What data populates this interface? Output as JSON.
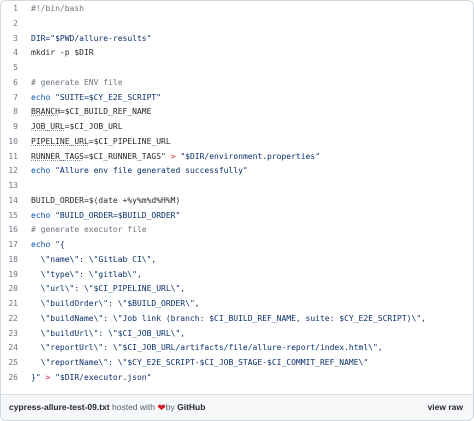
{
  "lines": [
    [
      {
        "t": "#!/bin/bash",
        "c": "t-comment"
      }
    ],
    [],
    [
      {
        "t": "DIR=\"$PWD/allure-results\"",
        "c": "t-str"
      }
    ],
    [
      {
        "t": "mkdir -p $DIR",
        "c": ""
      }
    ],
    [],
    [
      {
        "t": "# generate ENV file",
        "c": "t-comment"
      }
    ],
    [
      {
        "t": "echo",
        "c": "t-kw"
      },
      {
        "t": " \"SUITE=$CY_E2E_SCRIPT\"",
        "c": "t-str"
      }
    ],
    [
      {
        "t": "BRANCH",
        "c": "t-var"
      },
      {
        "t": "=$CI_BUILD_REF_NAME",
        "c": ""
      }
    ],
    [
      {
        "t": "JOB_URL",
        "c": "t-var"
      },
      {
        "t": "=$CI_JOB_URL",
        "c": ""
      }
    ],
    [
      {
        "t": "PIPELINE_URL",
        "c": "t-var"
      },
      {
        "t": "=$CI_PIPELINE_URL",
        "c": ""
      }
    ],
    [
      {
        "t": "RUNNER_TAGS",
        "c": "t-var"
      },
      {
        "t": "=$CI_RUNNER_TAGS\" ",
        "c": ""
      },
      {
        "t": ">",
        "c": "t-op"
      },
      {
        "t": " \"$DIR/environment.properties\"",
        "c": "t-str"
      }
    ],
    [
      {
        "t": "echo",
        "c": "t-kw"
      },
      {
        "t": " \"Allure env file generated successfully\"",
        "c": "t-str"
      }
    ],
    [],
    [
      {
        "t": "BUILD_ORDER=$(date +%y%m%d%H%M)",
        "c": ""
      }
    ],
    [
      {
        "t": "echo",
        "c": "t-kw"
      },
      {
        "t": " \"BUILD_ORDER=$BUILD_ORDER\"",
        "c": "t-str"
      }
    ],
    [
      {
        "t": "# generate executor file",
        "c": "t-comment"
      }
    ],
    [
      {
        "t": "echo",
        "c": "t-kw"
      },
      {
        "t": " \"{",
        "c": "t-str"
      }
    ],
    [
      {
        "t": "  \\\"name\\\": \\\"GitLab CI\\\",",
        "c": "t-str"
      }
    ],
    [
      {
        "t": "  \\\"type\\\": \\\"gitlab\\\",",
        "c": "t-str"
      }
    ],
    [
      {
        "t": "  \\\"url\\\": \\\"$CI_PIPELINE_URL\\\",",
        "c": "t-str"
      }
    ],
    [
      {
        "t": "  \\\"buildOrder\\\": \\\"$BUILD_ORDER\\\",",
        "c": "t-str"
      }
    ],
    [
      {
        "t": "  \\\"buildName\\\": \\\"Job link (branch: $CI_BUILD_REF_NAME, suite: $CY_E2E_SCRIPT)\\\",",
        "c": "t-str"
      }
    ],
    [
      {
        "t": "  \\\"buildUrl\\\": \\\"$CI_JOB_URL\\\",",
        "c": "t-str"
      }
    ],
    [
      {
        "t": "  \\\"reportUrl\\\": \\\"$CI_JOB_URL/artifacts/file/allure-report/index.html\\\",",
        "c": "t-str"
      }
    ],
    [
      {
        "t": "  \\\"reportName\\\": \\\"$CY_E2E_SCRIPT-$CI_JOB_STAGE-$CI_COMMIT_REF_NAME\\\"",
        "c": "t-str"
      }
    ],
    [
      {
        "t": "}\" ",
        "c": "t-str"
      },
      {
        "t": ">",
        "c": "t-op"
      },
      {
        "t": " \"$DIR/executor.json\"",
        "c": "t-str"
      }
    ]
  ],
  "footer": {
    "filename": "cypress-allure-test-09.txt",
    "hosted_with": " hosted with ",
    "heart": "❤",
    "by": "by ",
    "brand": "GitHub",
    "view_raw": "view raw"
  }
}
